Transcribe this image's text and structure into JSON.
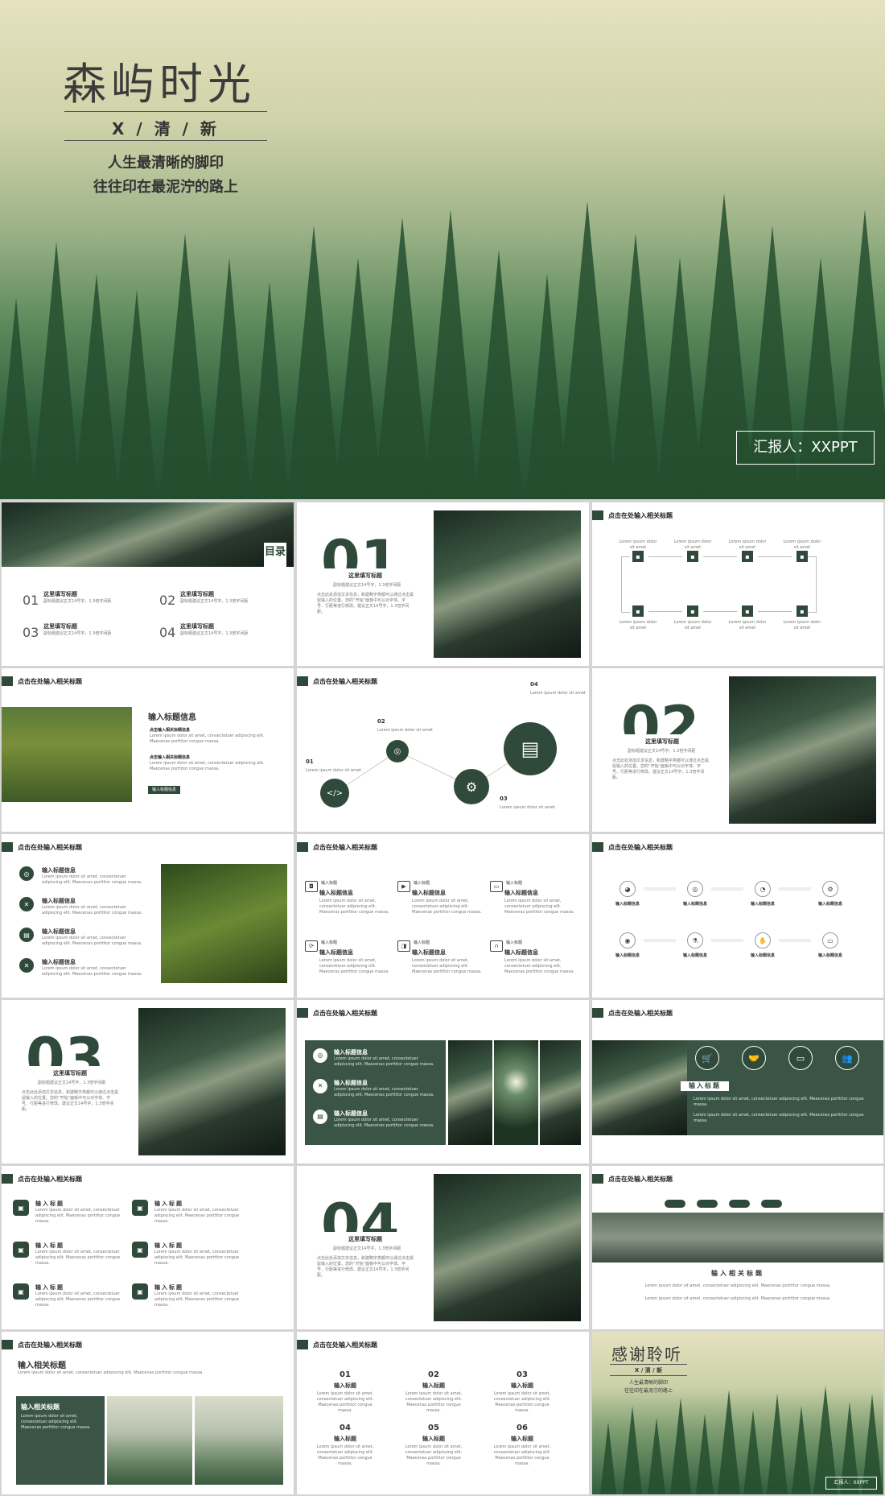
{
  "hero": {
    "title": "森屿时光",
    "subtitle": "X / 清 / 新",
    "tagline1": "人生最清晰的脚印",
    "tagline2": "往往印在最泥泞的路上",
    "reporter": "汇报人：XXPPT"
  },
  "toc": {
    "label": "目录",
    "items": [
      {
        "num": "01",
        "title": "这里填写标题",
        "desc": "副标题建议正文14号字，1.3倍字间距"
      },
      {
        "num": "02",
        "title": "这里填写标题",
        "desc": "副标题建议正文14号字，1.3倍字间距"
      },
      {
        "num": "03",
        "title": "这里填写标题",
        "desc": "副标题建议正文14号字，1.3倍字间距"
      },
      {
        "num": "04",
        "title": "这里填写标题",
        "desc": "副标题建议正文14号字，1.3倍字间距"
      }
    ]
  },
  "common": {
    "header": "点击在处输入相关标题",
    "section_title": "这里填写标题",
    "section_sub": "副标题建议正文14号字，1.3倍字间距",
    "section_body": "点击此处添加文本信息，和建略字类都可以通过点击黑鼠输入的位置。您的“开始”面板中可以对字体、字号、行距等进行修改。建议正文14号字，1.3倍字间距。",
    "lorem": "Lorem ipsum dolor sit amet, consectetuer adipiscing elit. Maecenas porttitor congue massa.",
    "lorem_short": "Lorem ipsum dolor sit amet",
    "input_title": "输入标题信息",
    "input_label": "输入标题",
    "input_related": "输入相关标题",
    "input_info": "输入标题信息",
    "bullet": "点击输入相关标题信息"
  },
  "sections": {
    "s1": "01",
    "s2": "02",
    "s3": "03",
    "s4": "04"
  },
  "timeline": {
    "n1": "01",
    "n2": "02",
    "n3": "03",
    "n4": "04"
  },
  "grid6": [
    "01",
    "02",
    "03",
    "04",
    "05",
    "06"
  ],
  "closing": {
    "title": "感谢聆听",
    "subtitle": "X / 清 / 新",
    "tagline1": "人生最清晰的脚印",
    "tagline2": "往往印在最泥泞的路上",
    "reporter": "汇报人：XXPPT"
  },
  "colors": {
    "accent": "#2f4a3b",
    "background": "#d4d4d4"
  }
}
